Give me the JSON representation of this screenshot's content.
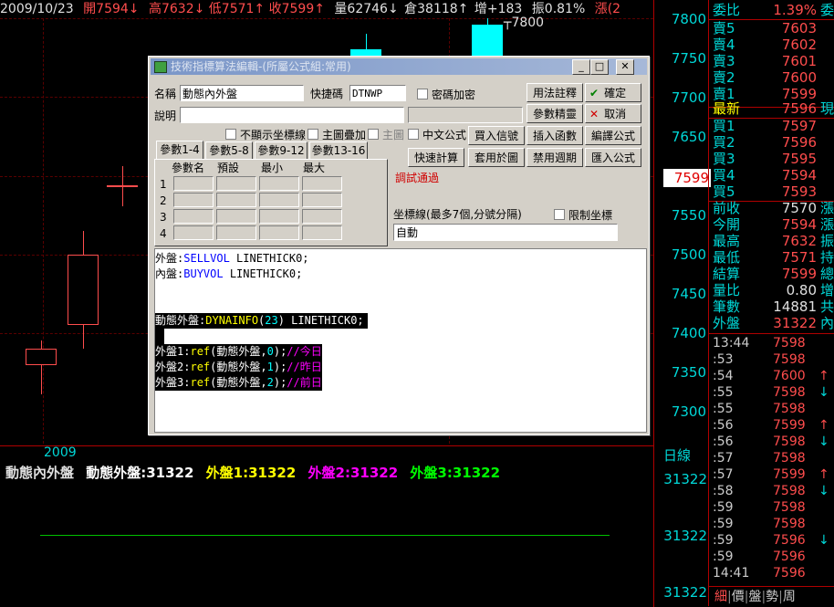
{
  "header": {
    "date": "2009/10/23",
    "open": "開7594↓",
    "high": "高7632↓",
    "low": "低7571↑",
    "close": "收7599↑",
    "volume": "量62746↓",
    "open_interest": "倉38118↑",
    "oi_change": "增+183",
    "amplitude": "振0.81%",
    "change": "漲(2"
  },
  "chart": {
    "price_ticks": [
      "7800",
      "7750",
      "7700",
      "7650",
      "7600",
      "7550",
      "7500",
      "7450",
      "7400",
      "7350",
      "7300"
    ],
    "current_price": "7599",
    "high_label": "7800",
    "year_label": "2009",
    "candles": [
      {
        "open": 7359,
        "close": 7380,
        "high": 7391,
        "low": 7322,
        "color": "#ff4d4d",
        "hollow": true
      },
      {
        "open": 7410,
        "close": 7500,
        "high": 7530,
        "low": 7380,
        "color": "#ff4d4d",
        "hollow": true
      },
      {
        "open": 7588,
        "close": 7588,
        "high": 7612,
        "low": 7561,
        "color": "#ff4d4d",
        "hollow": false
      },
      {
        "open": 7740,
        "close": 7760,
        "high": 7780,
        "low": 7720,
        "color": "#00ffff",
        "hollow": false
      },
      {
        "open": 7746,
        "close": 7792,
        "high": 7800,
        "low": 7730,
        "color": "#00ffff",
        "hollow": false
      }
    ]
  },
  "dialog": {
    "title": "技術指標算法編輯-(所屬公式組:常用)",
    "name_label": "名稱",
    "name_value": "動態內外盤",
    "shortcut_label": "快捷碼",
    "shortcut_value": "DTNWP",
    "encrypt_label": "密碼加密",
    "desc_label": "說明",
    "hide_axis_label": "不顯示坐標線",
    "main_overlay_label": "主圖疊加",
    "main_chart_label": "主圖",
    "chinese_formula_label": "中文公式",
    "tabs": [
      "參數1-4",
      "參數5-8",
      "參數9-12",
      "參數13-16"
    ],
    "param_headers": [
      "參數名",
      "預設",
      "最小",
      "最大"
    ],
    "param_rows": [
      "1",
      "2",
      "3",
      "4"
    ],
    "status": "調試通過",
    "axis_label": "坐標線(最多7個,分號分隔)",
    "limit_axis_label": "限制坐標",
    "axis_value": "自動",
    "buttons": {
      "usage": "用法註釋",
      "ok": "確定",
      "param_wizard": "參數精靈",
      "cancel": "取消",
      "buy_signal": "買入信號",
      "insert_func": "插入函數",
      "compile": "編譯公式",
      "quick_calc": "快速計算",
      "apply_chart": "套用於圖",
      "disable_period": "禁用週期",
      "import": "匯入公式"
    },
    "code": [
      {
        "a": "外盤",
        "b": ":",
        "c": "SELLVOL",
        "d": " LINETHICK0;"
      },
      {
        "a": "內盤",
        "b": ":",
        "c": "BUYVOL",
        "d": " LINETHICK0;"
      },
      {
        "a": "動態外盤",
        "b": ":",
        "c": "DYNAINFO",
        "d": "(",
        "e": "23",
        "f": ") LINETHICK0;"
      },
      {
        "a": "外盤1",
        "b": ":",
        "c": "ref",
        "d": "(動態外盤,",
        "e": "0",
        "f": ");",
        "g": "//今日"
      },
      {
        "a": "外盤2",
        "b": ":",
        "c": "ref",
        "d": "(動態外盤,",
        "e": "1",
        "f": ");",
        "g": "//昨日"
      },
      {
        "a": "外盤3",
        "b": ":",
        "c": "ref",
        "d": "(動態外盤,",
        "e": "2",
        "f": ");",
        "g": "//前日"
      }
    ]
  },
  "indicator": {
    "name": "動態內外盤",
    "v1": "動態外盤:31322",
    "v2": "外盤1:31322",
    "v3": "外盤2:31322",
    "v4": "外盤3:31322",
    "axis_label": "日線",
    "axis_values": [
      "31322",
      "31322",
      "31322"
    ],
    "colors": {
      "v1": "#ffffff",
      "v2": "#ffff00",
      "v3": "#ff00ff",
      "v4": "#00ff00"
    }
  },
  "quote": {
    "weibi_label": "委比",
    "weibi_value": "1.39%",
    "weibi_extra": "委",
    "asks": [
      {
        "k": "賣5",
        "v": "7603"
      },
      {
        "k": "賣4",
        "v": "7602"
      },
      {
        "k": "賣3",
        "v": "7601"
      },
      {
        "k": "賣2",
        "v": "7600"
      },
      {
        "k": "賣1",
        "v": "7599"
      }
    ],
    "last_label": "最新",
    "last_value": "7596",
    "last_extra": "現",
    "bids": [
      {
        "k": "買1",
        "v": "7597"
      },
      {
        "k": "買2",
        "v": "7596"
      },
      {
        "k": "買3",
        "v": "7595"
      },
      {
        "k": "買4",
        "v": "7594"
      },
      {
        "k": "買5",
        "v": "7593"
      }
    ],
    "stats": [
      {
        "k": "前收",
        "v": "7570",
        "e": "漲",
        "color": "#e0e0e0"
      },
      {
        "k": "今開",
        "v": "7594",
        "e": "漲",
        "color": "#ff4d4d"
      },
      {
        "k": "最高",
        "v": "7632",
        "e": "振",
        "color": "#ff4d4d"
      },
      {
        "k": "最低",
        "v": "7571",
        "e": "持",
        "color": "#ff4d4d"
      },
      {
        "k": "結算",
        "v": "7599",
        "e": "總",
        "color": "#ff4d4d"
      },
      {
        "k": "量比",
        "v": "0.80",
        "e": "增",
        "color": "#e0e0e0"
      },
      {
        "k": "筆數",
        "v": "14881",
        "e": "共",
        "color": "#e0e0e0"
      },
      {
        "k": "外盤",
        "v": "31322",
        "e": "內",
        "color": "#ff4d4d"
      }
    ],
    "ticks": [
      {
        "t": "13:44",
        "p": "7598",
        "a": ""
      },
      {
        "t": ":53",
        "p": "7598",
        "a": ""
      },
      {
        "t": ":54",
        "p": "7600",
        "a": "↑"
      },
      {
        "t": ":55",
        "p": "7598",
        "a": "↓"
      },
      {
        "t": ":55",
        "p": "7598",
        "a": ""
      },
      {
        "t": ":56",
        "p": "7599",
        "a": "↑"
      },
      {
        "t": ":56",
        "p": "7598",
        "a": "↓"
      },
      {
        "t": ":57",
        "p": "7598",
        "a": ""
      },
      {
        "t": ":57",
        "p": "7599",
        "a": "↑"
      },
      {
        "t": ":58",
        "p": "7598",
        "a": "↓"
      },
      {
        "t": ":59",
        "p": "7598",
        "a": ""
      },
      {
        "t": ":59",
        "p": "7598",
        "a": ""
      },
      {
        "t": ":59",
        "p": "7596",
        "a": "↓"
      },
      {
        "t": ":59",
        "p": "7596",
        "a": ""
      },
      {
        "t": "14:41",
        "p": "7596",
        "a": ""
      }
    ],
    "bottom_tabs": [
      "細",
      "價",
      "盤",
      "勢",
      "周"
    ]
  }
}
